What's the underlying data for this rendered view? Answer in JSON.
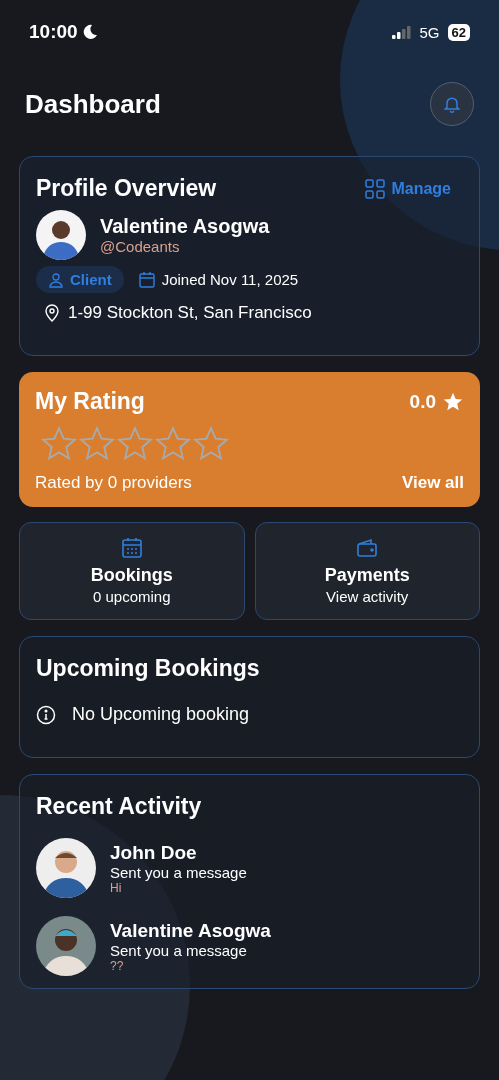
{
  "status_bar": {
    "time": "10:00",
    "network": "5G",
    "battery": "62"
  },
  "header": {
    "title": "Dashboard"
  },
  "profile": {
    "title": "Profile Overview",
    "manage": "Manage",
    "name": "Valentine Asogwa",
    "handle": "@Codeants",
    "role": "Client",
    "joined": "Joined Nov 11, 2025",
    "address": "1-99 Stockton St, San Francisco"
  },
  "rating": {
    "title": "My Rating",
    "score": "0.0",
    "stars": 0,
    "caption": "Rated by 0 providers",
    "link": "View all"
  },
  "tiles": [
    {
      "kind": "calendar",
      "title": "Bookings",
      "subtitle": "0 upcoming"
    },
    {
      "kind": "wallet",
      "title": "Payments",
      "subtitle": "View activity"
    }
  ],
  "upcoming": {
    "title": "Upcoming Bookings",
    "empty": "No Upcoming booking"
  },
  "activity": {
    "title": "Recent Activity",
    "items": [
      {
        "name": "John Doe",
        "action": "Sent you a message",
        "message": "Hi"
      },
      {
        "name": "Valentine Asogwa",
        "action": "Sent you a message",
        "message": "??"
      }
    ]
  }
}
